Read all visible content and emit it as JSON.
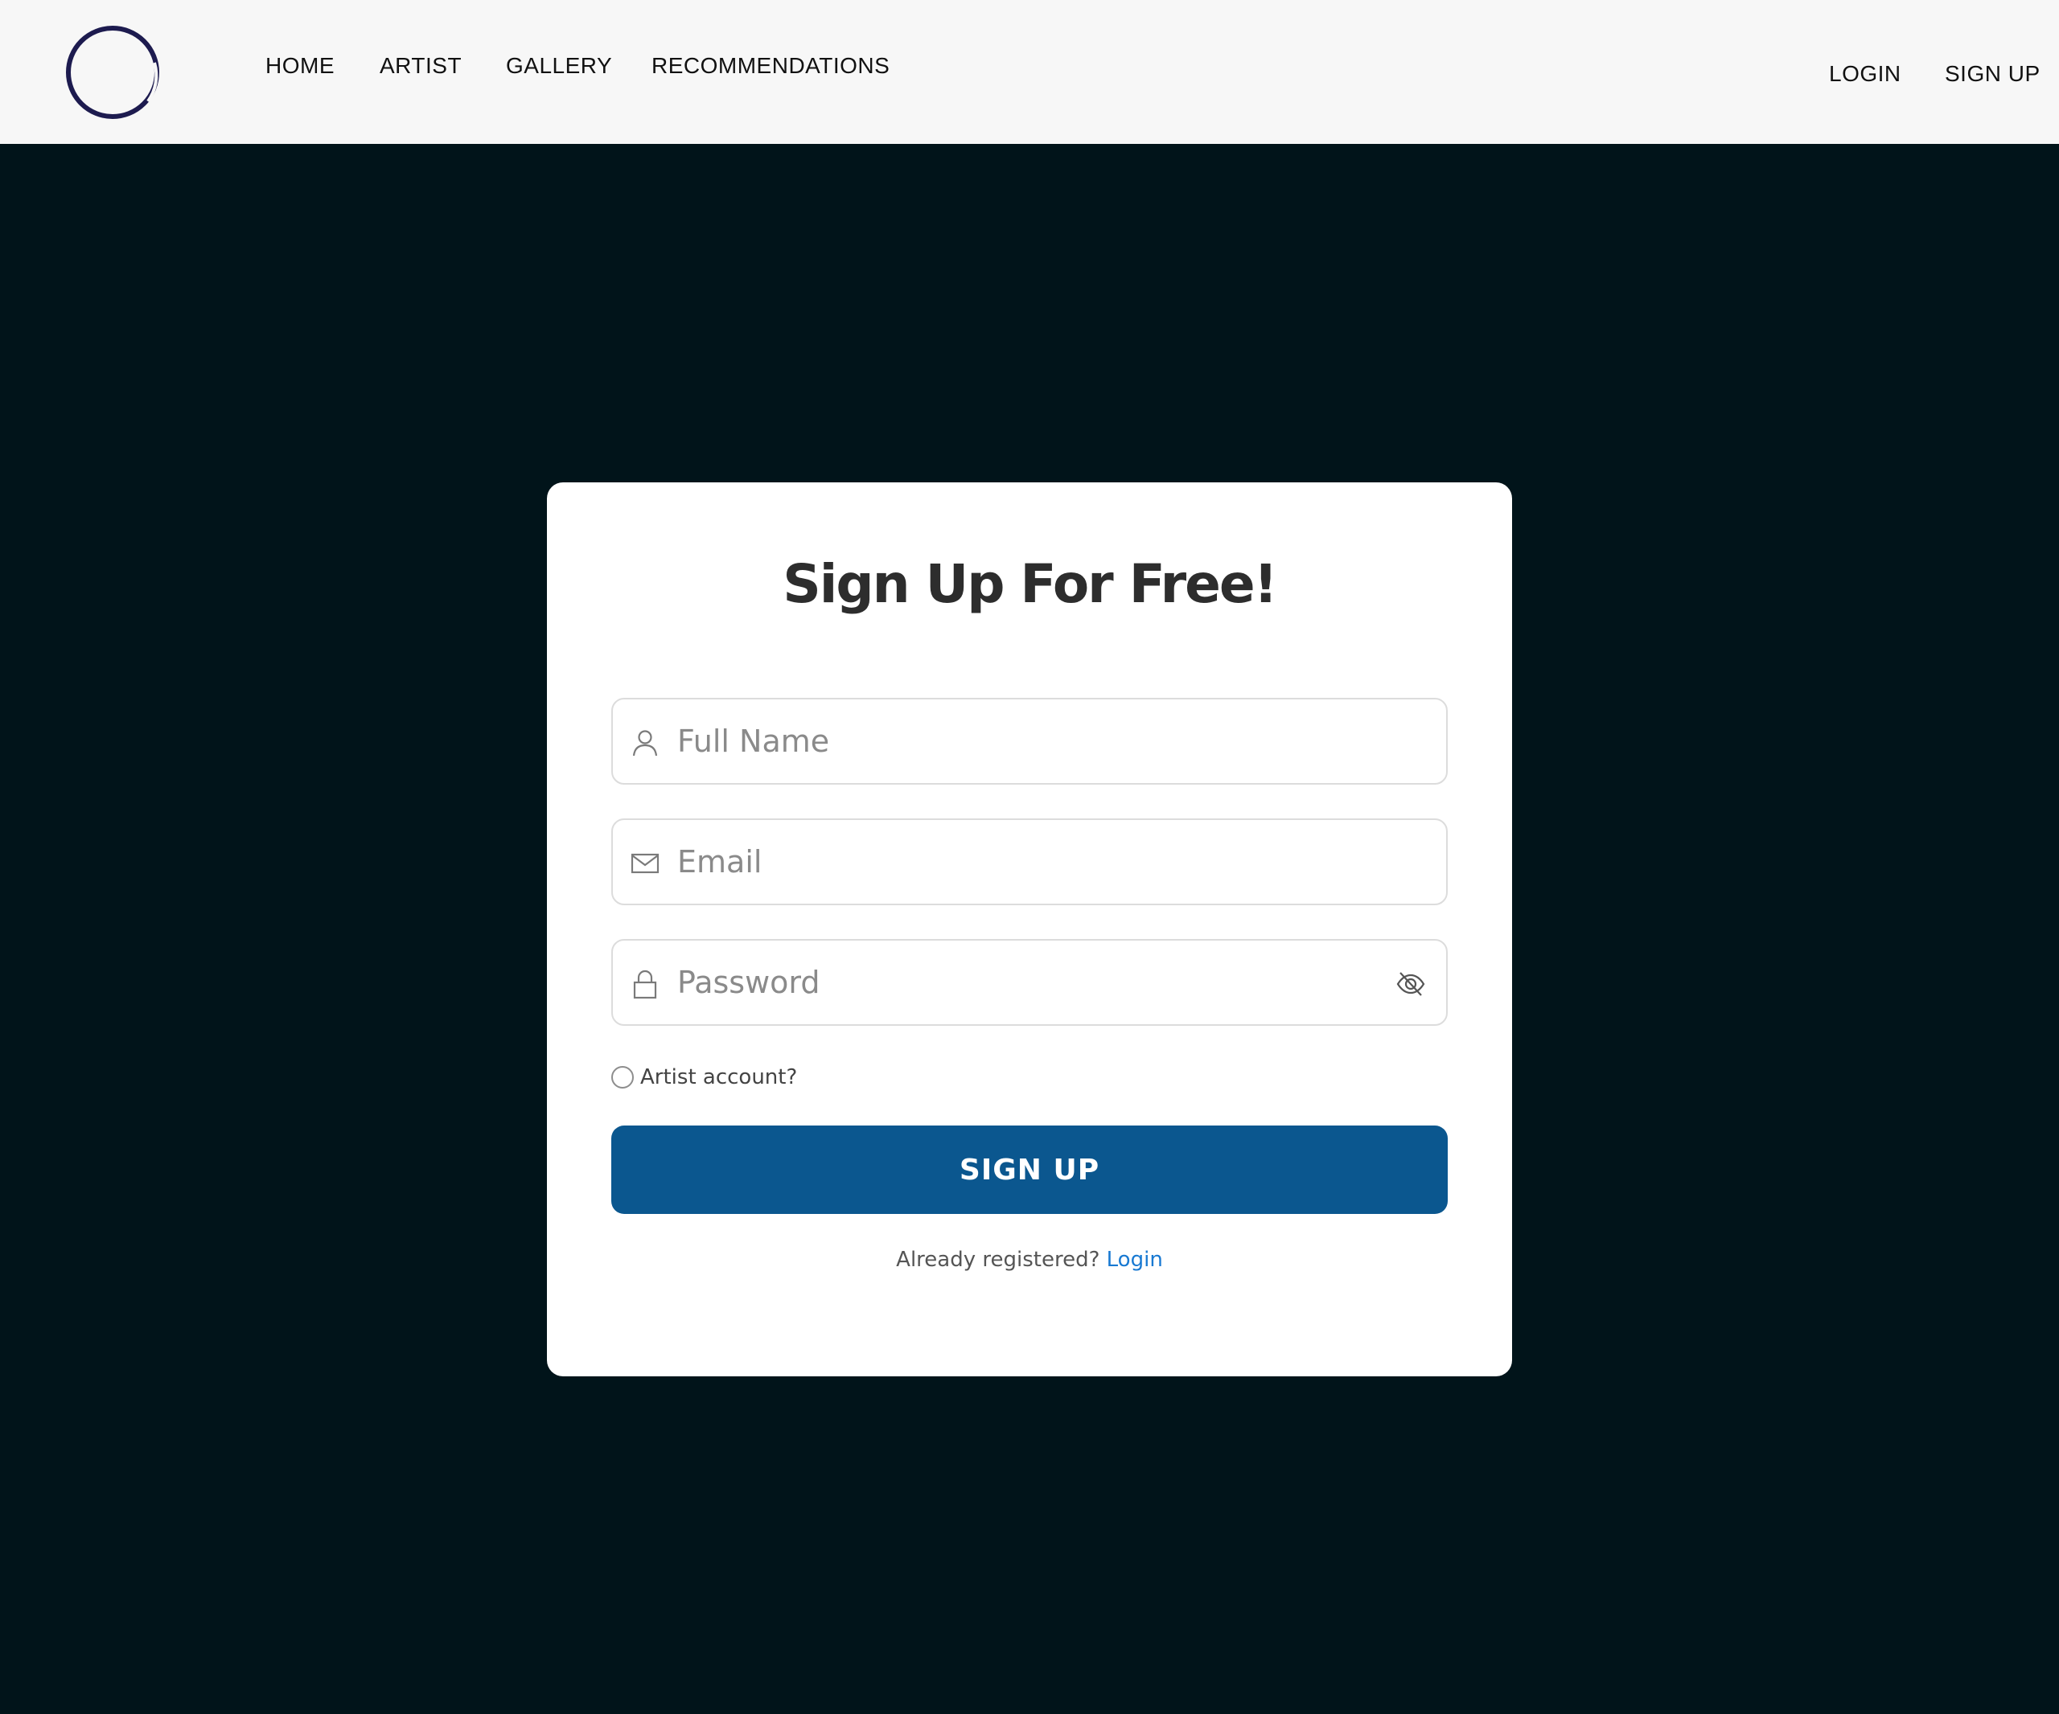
{
  "header": {
    "logo_icon": "ring-logo-icon",
    "nav": [
      "HOME",
      "ARTIST",
      "GALLERY",
      "RECOMMENDATIONS"
    ],
    "auth": {
      "login": "LOGIN",
      "signup": "SIGN UP"
    }
  },
  "form": {
    "title": "Sign Up For Free!",
    "fields": {
      "name": {
        "placeholder": "Full Name",
        "icon": "user-icon"
      },
      "email": {
        "placeholder": "Email",
        "icon": "envelope-icon"
      },
      "password": {
        "placeholder": "Password",
        "icon": "lock-icon",
        "toggle_icon": "eye-slash-icon"
      }
    },
    "artist_option": "Artist account?",
    "submit_label": "SIGN UP",
    "already_text": "Already registered?",
    "login_link": "Login"
  },
  "colors": {
    "page_bg": "#01141a",
    "header_bg": "#f7f7f7",
    "button": "#0b578f",
    "link": "#1879d2",
    "logo": "#1d1b4f"
  }
}
